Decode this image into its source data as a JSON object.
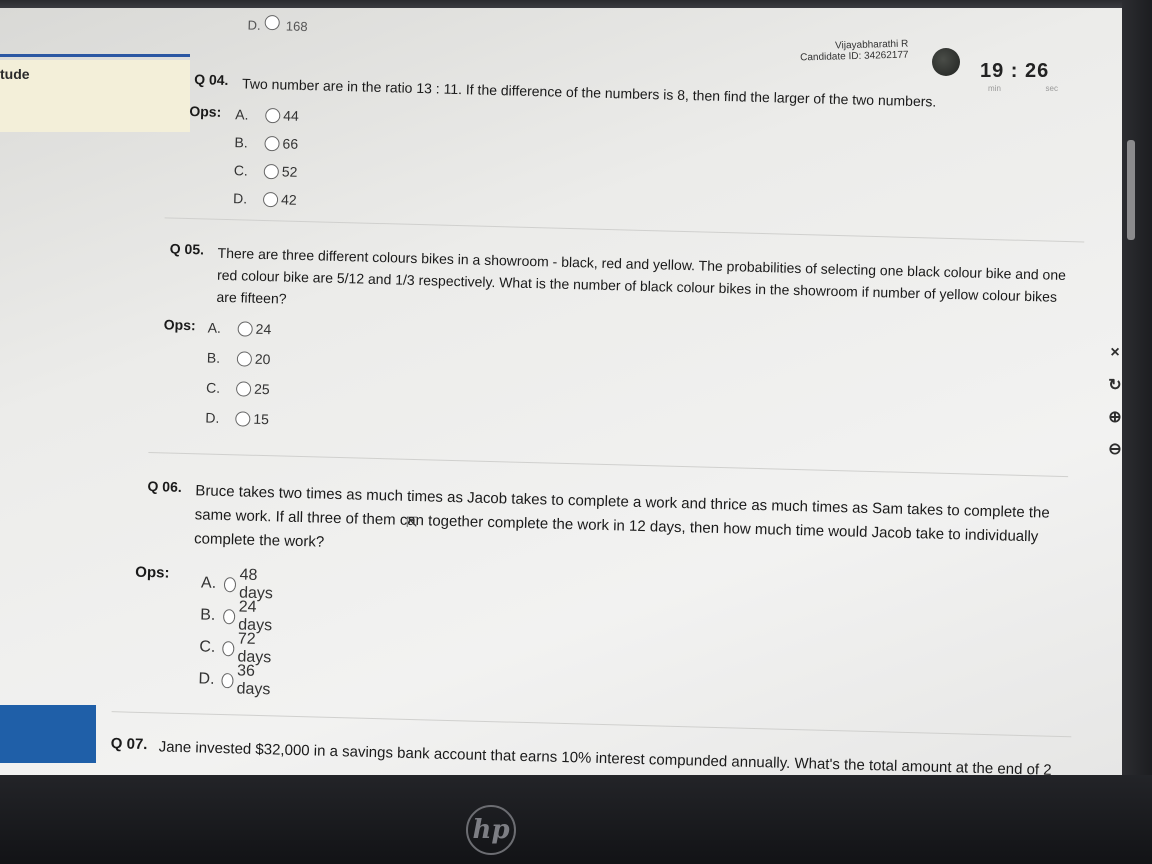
{
  "header": {
    "prev_option_letter": "D.",
    "prev_option_value": "168",
    "candidate_name": "Vijayabharathi R",
    "candidate_id": "Candidate ID: 34262177",
    "timer": "19 : 26",
    "timer_min_label": "min",
    "timer_sec_label": "sec"
  },
  "sidebar": {
    "tab_label": "tude"
  },
  "questions": [
    {
      "number": "Q 04.",
      "text": "Two number are in the ratio 13 : 11. If the difference of the numbers is 8, then find the larger of the two numbers.",
      "ops_label": "Ops:",
      "options": [
        {
          "letter": "A.",
          "value": "44"
        },
        {
          "letter": "B.",
          "value": "66"
        },
        {
          "letter": "C.",
          "value": "52"
        },
        {
          "letter": "D.",
          "value": "42"
        }
      ]
    },
    {
      "number": "Q 05.",
      "text": "There are three different colours bikes in a showroom - black, red and yellow. The probabilities of selecting one black colour bike and one red colour bike are 5/12 and 1/3 respectively. What is the number of black colour bikes in the showroom if number of yellow colour bikes are fifteen?",
      "ops_label": "Ops:",
      "options": [
        {
          "letter": "A.",
          "value": "24"
        },
        {
          "letter": "B.",
          "value": "20"
        },
        {
          "letter": "C.",
          "value": "25"
        },
        {
          "letter": "D.",
          "value": "15"
        }
      ]
    },
    {
      "number": "Q 06.",
      "text": "Bruce takes two times as much times as Jacob takes to complete a work and thrice as much times as Sam takes to complete the same work. If all three of them can together complete the work in 12 days, then how much time would Jacob take to individually complete the work?",
      "ops_label": "Ops:",
      "options": [
        {
          "letter": "A.",
          "value": "48 days"
        },
        {
          "letter": "B.",
          "value": "24 days"
        },
        {
          "letter": "C.",
          "value": "72 days"
        },
        {
          "letter": "D.",
          "value": "36 days"
        }
      ]
    },
    {
      "number": "Q 07.",
      "text": "Jane invested $32,000 in a savings bank account that earns 10% interest compunded annually. What's the total amount at the end of 2"
    }
  ],
  "toolbar": {
    "close_icon": "×",
    "rotate_icon": "↻",
    "zoom_in_icon": "⊕",
    "zoom_out_icon": "⊖"
  },
  "laptop": {
    "brand": "hp"
  }
}
